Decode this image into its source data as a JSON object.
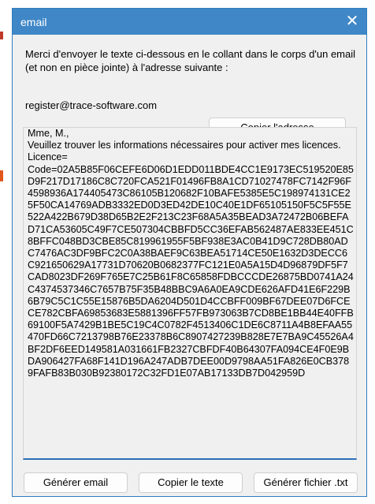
{
  "window": {
    "title": "email",
    "close_glyph": "✕"
  },
  "instruction": "Merci d'envoyer le texte ci-dessous en le collant dans le corps d'un email (et non en pièce jointe)  à l'adresse suivante  :",
  "email_address": "register@trace-software.com",
  "copy_address_label": "Copier l'adresse",
  "message_text": "Mme, M.,\nVeuillez trouver les informations nécessaires pour activer mes licences.\nLicence=\nCode=02A5B85F06CEFE6D06D1EDD011BDE4CC1E9173EC519520E85D9F217D17186C8C720FCA521F01496FB8A1CD71027478FC7142F96F4598936A174405473C86105B120682F10BAFE5385E5C198974131CE25F50CA14769ADB3332ED0D3ED42DE10C40E1DF65105150F5C5F55E522A422B679D38D65B2E2F213C23F68A5A35BEAD3A72472B06BEFAD71CA53605C49F7CE507304CBBFD5CC36EFAB562487AE833EE451C8BFFC048BD3CBE85C819961955F5BF938E3AC0B41D9C728DB80ADC7476AC3DF9BFC2C0A38BAEF9C63BEA51714CE50E1632D3DECC6C921650629A17731D70620B0682377FC121E0A5A15D4D96879DF5F7CAD8023DF269F765E7C25B61F8C65858FDBCCCDE26875BD0741A24C4374537346C7657B75F35B48BBC9A6A0EA9CDE626AFD41E6F229B6B79C5C1C55E15876B5DA6204D501D4CCBFF009BF67DEE07D6FCECE782CBFA69853683E5881396FF57FB973063B7CD8BE1BB44E40FFB69100F5A7429B1BE5C19C4C0782F4513406C1DE6C8711A4B8EFAA55470FD66C7213798B76E23378B6C8907427239B828E7E7BA9C45526A4BF2DF6EED149581A031661FB2327CBFDF40B64307FA094CE4F0E9BDA906427FA68F141D196A247ADB7DEE00D9798AA51FA826E0CB3789FAFB83B030B92380172C32FD1E07AB17133DB7D042959D",
  "buttons": {
    "generate_email": "Générer email",
    "copy_text": "Copier le texte",
    "generate_file": "Générer fichier .txt"
  },
  "colors": {
    "titlebar": "#3f87c7",
    "dialog_bg": "#f0f0f0",
    "accent": "#2a6fb5"
  }
}
